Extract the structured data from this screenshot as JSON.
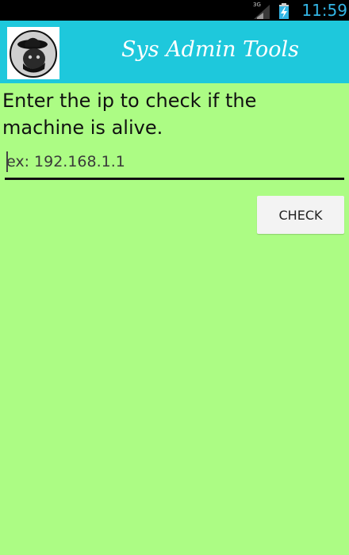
{
  "status_bar": {
    "network_label": "3G",
    "signal_icon": "signal-icon",
    "battery_icon": "battery-charging-icon",
    "time": "11:59",
    "time_color": "#33b5e5"
  },
  "app_bar": {
    "title": "Sys Admin Tools",
    "logo_icon": "fedora-logo-icon",
    "color": "#1ec8dc"
  },
  "main": {
    "prompt": "Enter the ip to check if the machine is alive.",
    "ip_input": {
      "value": "",
      "placeholder": "ex: 192.168.1.1"
    },
    "check_button_label": "CHECK",
    "background_color": "#acfc84"
  }
}
